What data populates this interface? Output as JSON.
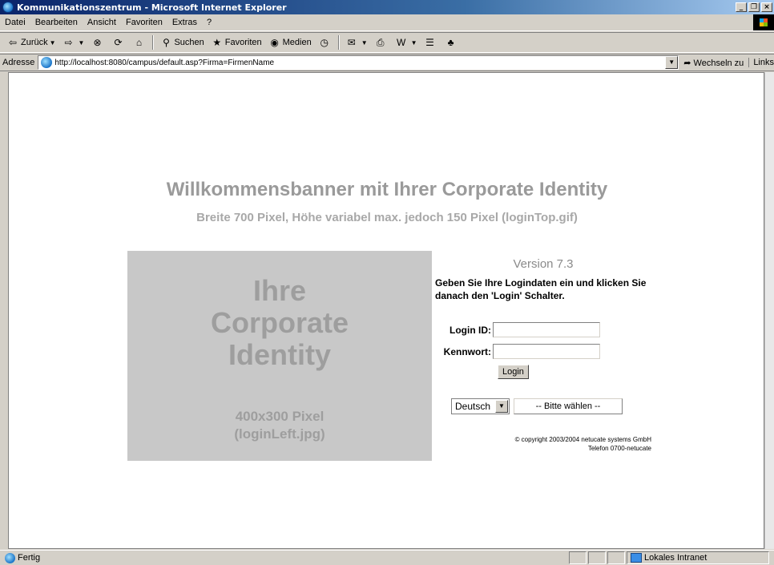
{
  "window": {
    "title": "Kommunikationszentrum - Microsoft Internet Explorer"
  },
  "menu": [
    "Datei",
    "Bearbeiten",
    "Ansicht",
    "Favoriten",
    "Extras",
    "?"
  ],
  "toolbar": {
    "back": "Zurück",
    "search": "Suchen",
    "favorites": "Favoriten",
    "media": "Medien"
  },
  "address": {
    "label": "Adresse",
    "url": "http://localhost:8080/campus/default.asp?Firma=FirmenName",
    "go": "Wechseln zu",
    "links": "Links"
  },
  "page": {
    "banner_title": "Willkommensbanner mit Ihrer Corporate Identity",
    "banner_sub": "Breite 700 Pixel, Höhe variabel max. jedoch 150 Pixel (loginTop.gif)",
    "corp_big": "Ihre\nCorporate\nIdentity",
    "corp_small": "400x300 Pixel\n(loginLeft.jpg)",
    "version": "Version 7.3",
    "instructions": "Geben Sie Ihre Logindaten ein und klicken Sie danach den 'Login' Schalter.",
    "login_id_label": "Login ID:",
    "password_label": "Kennwort:",
    "login_button": "Login",
    "language": "Deutsch",
    "choose": "-- Bitte wählen --",
    "copyright": "© copyright 2003/2004 netucate systems GmbH\nTelefon 0700-netucate"
  },
  "status": {
    "text": "Fertig",
    "zone": "Lokales Intranet"
  }
}
